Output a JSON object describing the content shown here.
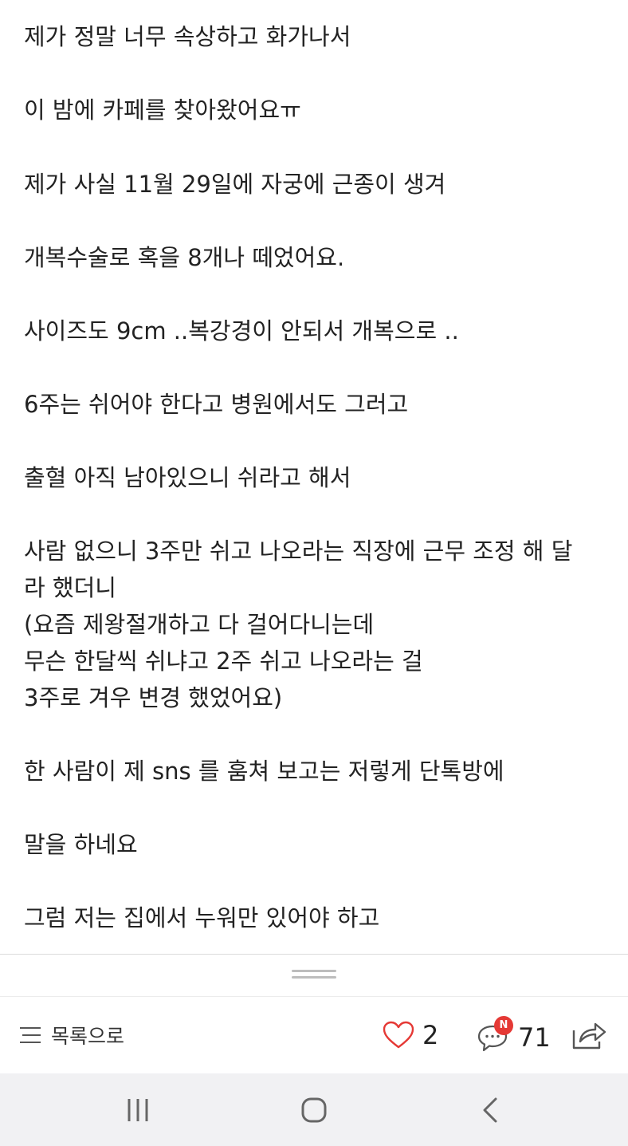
{
  "post": {
    "lines": [
      "제가 정말 너무 속상하고 화가나서",
      "이 밤에 카페를 찾아왔어요ㅠ",
      "제가 사실 11월 29일에 자궁에 근종이 생겨",
      "개복수술로 혹을 8개나 떼었어요.",
      "사이즈도 9cm ..복강경이 안되서 개복으로 ..",
      "6주는 쉬어야 한다고 병원에서도 그러고",
      "출혈 아직 남아있으니 쉬라고 해서",
      "사람 없으니 3주만 쉬고 나오라는 직장에 근무 조정 해 달",
      "라 했더니",
      "(요즘 제왕절개하고 다 걸어다니는데",
      "무슨 한달씩 쉬냐고 2주 쉬고 나오라는 걸",
      "3주로 겨우 변경 했었어요)",
      "한 사람이 제 sns 를 훔쳐 보고는 저렇게 단톡방에",
      "말을 하네요",
      "그럼 저는 집에서 누워만 있어야 하고"
    ]
  },
  "toolbar": {
    "list_label": "목록으로",
    "like_count": "2",
    "comment_badge": "N",
    "comment_count": "71"
  },
  "icons": {
    "list": "list-icon",
    "like": "heart-icon",
    "comment": "comment-icon",
    "share": "share-icon",
    "nav_recent": "recent-apps-icon",
    "nav_home": "home-icon",
    "nav_back": "back-icon"
  },
  "colors": {
    "heart": "#e53935",
    "badge": "#e53935",
    "text": "#222222",
    "navbar_bg": "#f1f1f3"
  }
}
